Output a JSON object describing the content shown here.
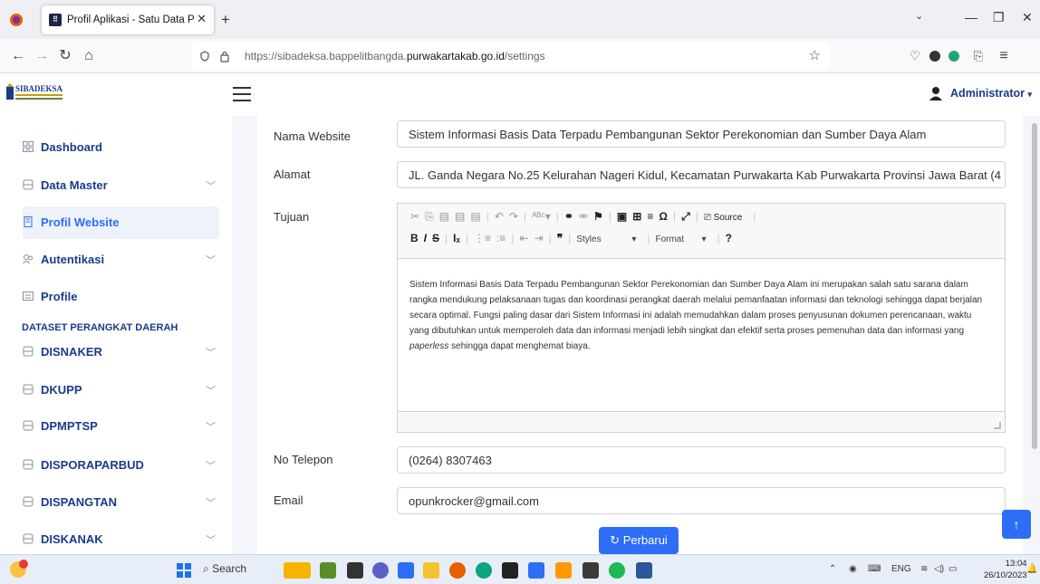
{
  "browser": {
    "tab_title": "Profil Aplikasi - Satu Data Purw",
    "tab_favicon": "⠿",
    "url_prefix": "https://sibadeksa.bappelitbangda.",
    "url_domain": "purwakartakab.go.id",
    "url_suffix": "/settings"
  },
  "header": {
    "logo_text": "SIBADEKSA",
    "user_label": "Administrator"
  },
  "sidebar": {
    "items": [
      {
        "label": "Dashboard",
        "icon": "grid-icon"
      },
      {
        "label": "Data Master",
        "icon": "database-icon"
      },
      {
        "label": "Profil Website",
        "icon": "building-icon"
      },
      {
        "label": "Autentikasi",
        "icon": "users-icon"
      },
      {
        "label": "Profile",
        "icon": "profile-card-icon"
      }
    ],
    "section_title": "DATASET PERANGKAT DAERAH",
    "datasets": [
      "DISNAKER",
      "DKUPP",
      "DPMPTSP",
      "DISPORAPARBUD",
      "DISPANGTAN",
      "DISKANAK"
    ]
  },
  "form": {
    "nama_label": "Nama Website",
    "nama_value": "Sistem Informasi Basis Data Terpadu Pembangunan Sektor Perekonomian dan Sumber Daya Alam",
    "alamat_label": "Alamat",
    "alamat_value": "JL. Ganda Negara No.25 Kelurahan Nageri Kidul, Kecamatan Purwakarta Kab Purwakarta Provinsi Jawa Barat (4",
    "tujuan_label": "Tujuan",
    "tujuan_text_1": "Sistem Informasi Basis Data Terpadu Pembangunan Sektor Perekonomian dan Sumber Daya Alam ini merupakan salah satu sarana dalam rangka mendukung pelaksanaan tugas dan koordinasi perangkat daerah melalui pemanfaatan informasi dan teknologi sehingga dapat berjalan secara optimal. Fungsi paling dasar dari Sistem Informasi ini adalah memudahkan dalam proses penyusunan dokumen perencanaan, waktu yang dibutuhkan untuk memperoleh data dan informasi menjadi lebih singkat dan efektif serta proses pemenuhan data dan informasi yang ",
    "tujuan_text_em": "paperless",
    "tujuan_text_2": " sehingga dapat menghemat biaya.",
    "telp_label": "No Telepon",
    "telp_value": "(0264) 8307463",
    "email_label": "Email",
    "email_value": "opunkrocker@gmail.com",
    "submit_label": "Perbarui"
  },
  "editor": {
    "source_label": "Source",
    "styles_label": "Styles",
    "format_label": "Format"
  },
  "taskbar": {
    "search_label": "Search",
    "lang": "ENG",
    "time": "13:04",
    "date": "26/10/2023"
  }
}
